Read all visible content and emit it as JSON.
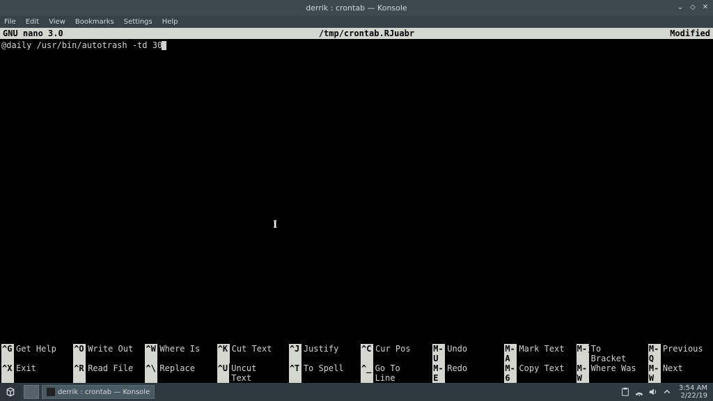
{
  "window": {
    "title": "derrik : crontab — Konsole"
  },
  "menubar": [
    "File",
    "Edit",
    "View",
    "Bookmarks",
    "Settings",
    "Help"
  ],
  "nano": {
    "version": "GNU nano 3.0",
    "filename": "/tmp/crontab.RJuabr",
    "status": "Modified",
    "content": "@daily /usr/bin/autotrash -td 30",
    "shortcuts_row1": [
      {
        "key": "^G",
        "desc": "Get Help"
      },
      {
        "key": "^O",
        "desc": "Write Out"
      },
      {
        "key": "^W",
        "desc": "Where Is"
      },
      {
        "key": "^K",
        "desc": "Cut Text"
      },
      {
        "key": "^J",
        "desc": "Justify"
      },
      {
        "key": "^C",
        "desc": "Cur Pos"
      },
      {
        "key": "M-U",
        "desc": "Undo"
      },
      {
        "key": "M-A",
        "desc": "Mark Text"
      },
      {
        "key": "M-]",
        "desc": "To Bracket"
      },
      {
        "key": "M-Q",
        "desc": "Previous"
      }
    ],
    "shortcuts_row2": [
      {
        "key": "^X",
        "desc": "Exit"
      },
      {
        "key": "^R",
        "desc": "Read File"
      },
      {
        "key": "^\\",
        "desc": "Replace"
      },
      {
        "key": "^U",
        "desc": "Uncut Text"
      },
      {
        "key": "^T",
        "desc": "To Spell"
      },
      {
        "key": "^_",
        "desc": "Go To Line"
      },
      {
        "key": "M-E",
        "desc": "Redo"
      },
      {
        "key": "M-6",
        "desc": "Copy Text"
      },
      {
        "key": "M-W",
        "desc": "Where Was"
      },
      {
        "key": "M-W",
        "desc": "Next"
      }
    ]
  },
  "taskbar": {
    "task_label": "derrik : crontab — Konsole",
    "clock_time": "3:54 AM",
    "clock_date": "2/22/19"
  }
}
